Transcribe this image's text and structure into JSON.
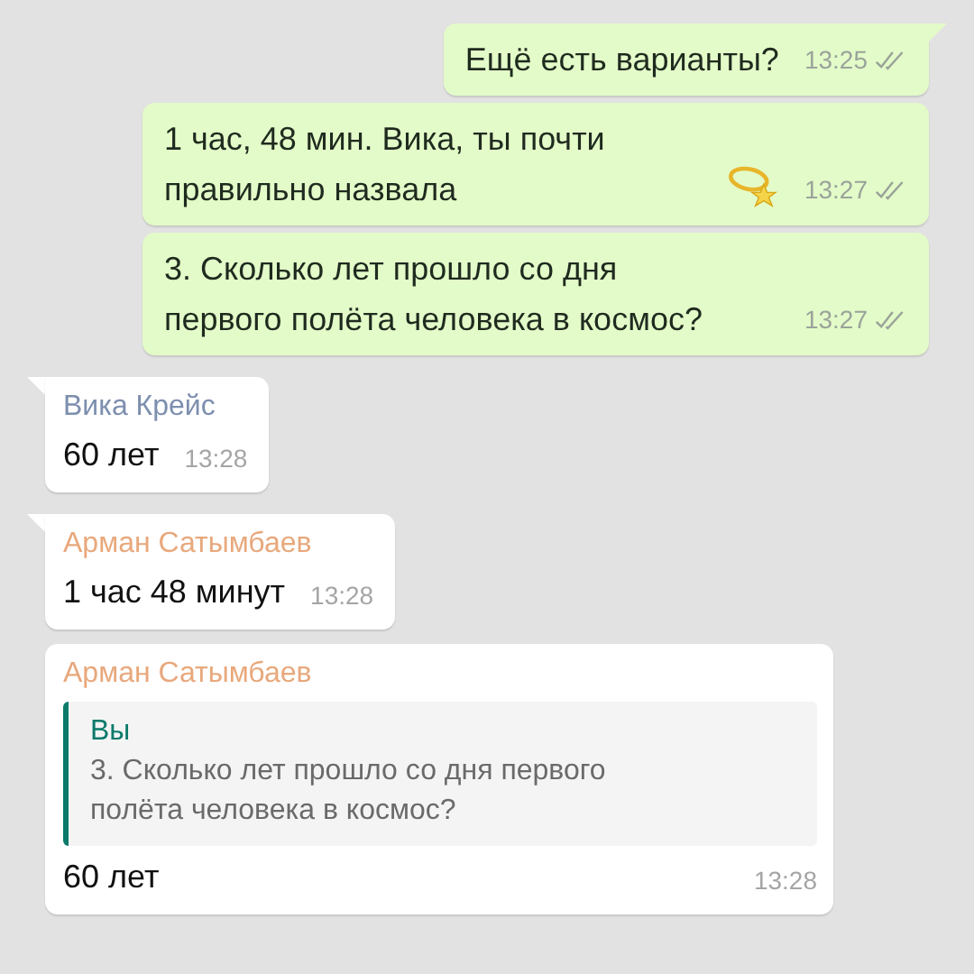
{
  "messages": [
    {
      "kind": "outgoing",
      "text": "Ещё есть варианты?",
      "time": "13:25",
      "tail": true
    },
    {
      "kind": "outgoing",
      "text": "1 час, 48 мин. Вика, ты почти правильно назвала",
      "trailing_icon": true,
      "time": "13:27",
      "tail": false
    },
    {
      "kind": "outgoing",
      "text": "3. Сколько лет прошло со дня первого полёта человека в космос?",
      "time": "13:27",
      "tail": false
    },
    {
      "kind": "incoming",
      "sender": "Вика Крейс",
      "color": "#7d8fae",
      "tail": true,
      "text": "60 лет",
      "time": "13:28"
    },
    {
      "kind": "incoming",
      "sender": "Арман Сатымбаев",
      "color": "#e8a87c",
      "tail": true,
      "text": "1 час 48 минут",
      "time": "13:28"
    },
    {
      "kind": "incoming",
      "sender": "Арман Сатымбаев",
      "color": "#e8a87c",
      "tail": false,
      "quote": {
        "author": "Вы",
        "text": "3. Сколько лет прошло со дня первого полёта человека в космос?"
      },
      "text": "60 лет",
      "time": "13:28"
    }
  ]
}
